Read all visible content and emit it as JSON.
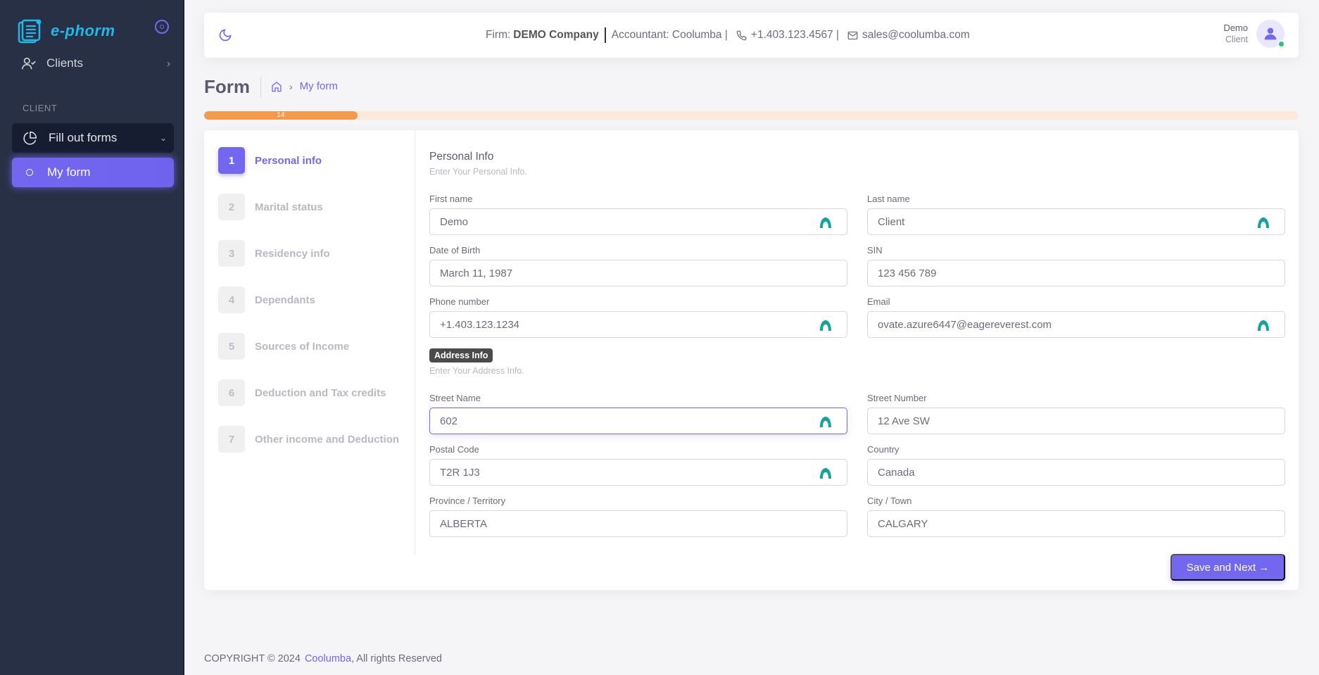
{
  "app": {
    "brand": "e-phorm"
  },
  "sidebar": {
    "clients_label": "Clients",
    "section_label": "CLIENT",
    "fill_forms_label": "Fill out forms",
    "my_form_label": "My form"
  },
  "header": {
    "firm_prefix": "Firm:",
    "firm_name": "DEMO Company",
    "accountant": "Accountant: Coolumba |",
    "phone": "+1.403.123.4567 |",
    "email": "sales@coolumba.com",
    "user_name": "Demo",
    "user_role": "Client"
  },
  "page": {
    "title": "Form",
    "breadcrumb_current": "My form"
  },
  "progress": {
    "value_percent": 14,
    "label": "14"
  },
  "steps": [
    {
      "num": "1",
      "label": "Personal info"
    },
    {
      "num": "2",
      "label": "Marital status"
    },
    {
      "num": "3",
      "label": "Residency info"
    },
    {
      "num": "4",
      "label": "Dependants"
    },
    {
      "num": "5",
      "label": "Sources of Income"
    },
    {
      "num": "6",
      "label": "Deduction and Tax credits"
    },
    {
      "num": "7",
      "label": "Other income and Deduction"
    }
  ],
  "personal": {
    "title": "Personal Info",
    "subtitle": "Enter Your Personal Info.",
    "first_name": {
      "label": "First name",
      "value": "Demo"
    },
    "last_name": {
      "label": "Last name",
      "value": "Client"
    },
    "dob": {
      "label": "Date of Birth",
      "value": "March 11, 1987"
    },
    "sin": {
      "label": "SIN",
      "value": "123 456 789"
    },
    "phone": {
      "label": "Phone number",
      "value": "+1.403.123.1234"
    },
    "email": {
      "label": "Email",
      "value": "ovate.azure6447@eagereverest.com"
    }
  },
  "address": {
    "title": "Address Info",
    "subtitle": "Enter Your Address Info.",
    "street_name": {
      "label": "Street Name",
      "value": "602"
    },
    "street_number": {
      "label": "Street Number",
      "value": "12 Ave SW"
    },
    "postal_code": {
      "label": "Postal Code",
      "value": "T2R 1J3"
    },
    "country": {
      "label": "Country",
      "value": "Canada"
    },
    "province": {
      "label": "Province / Territory",
      "value": "ALBERTA"
    },
    "city": {
      "label": "City / Town",
      "value": "CALGARY"
    }
  },
  "actions": {
    "save_next": "Save and Next →"
  },
  "footer": {
    "copyright": "COPYRIGHT © 2024",
    "company": "Coolumba",
    "rights": ", All rights Reserved"
  },
  "colors": {
    "primary": "#7367f0",
    "sidebar": "#283046",
    "progress": "#f39a4c",
    "grammarly": "#15c39a"
  },
  "icons": [
    "logo-icon",
    "collapse-icon",
    "user-check-icon",
    "pie-chart-icon",
    "chevron-right-icon",
    "chevron-down-icon",
    "circle-icon",
    "moon-icon",
    "phone-icon",
    "mail-icon",
    "home-icon",
    "user-avatar-icon",
    "grammarly-icon",
    "arrow-right-icon"
  ]
}
